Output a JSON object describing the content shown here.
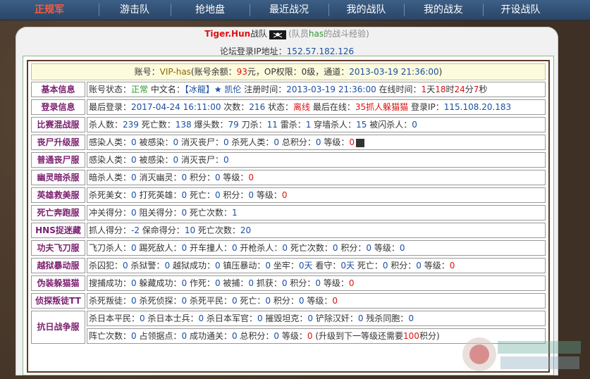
{
  "nav": {
    "items": [
      {
        "label": "正规军",
        "active": true
      },
      {
        "label": "游击队",
        "active": false
      },
      {
        "label": "抢地盘",
        "active": false
      },
      {
        "label": "最近战况",
        "active": false
      },
      {
        "label": "我的战队",
        "active": false
      },
      {
        "label": "我的战友",
        "active": false
      },
      {
        "label": "开设战队",
        "active": false
      }
    ]
  },
  "team": {
    "name": "Tiger.Hun",
    "suffix": "战队",
    "note_prefix": "(队员",
    "member": "has",
    "note_suffix": "的战斗经验)"
  },
  "ip": {
    "label": "论坛登录IP地址：",
    "value": "152.57.182.126"
  },
  "account": {
    "p1": "账号：",
    "id": "VIP-has",
    "p2": "(账号余额：",
    "balance": "93",
    "p3": "元，OP权限：0级，通道：",
    "date": "2013-03-19 21:36:00",
    "p4": ")"
  },
  "basic": {
    "cat": "基本信息",
    "status_label": "账号状态：",
    "status": "正常",
    "cn_label": " 中文名：",
    "cn": "【冰龍】★ 凯伦",
    "reg_label": " 注册时间：",
    "reg": "2013-03-19 21:36:00",
    "online_label": " 在线时间：",
    "d": "1",
    "d_u": "天",
    "h": "18",
    "h_u": "时",
    "m": "24",
    "m_u": "分",
    "s": "7",
    "s_u": "秒"
  },
  "login": {
    "cat": "登录信息",
    "last_label": "最后登录：",
    "last": "2017-04-24 16:11:00",
    "count_label": " 次数：",
    "count": "216",
    "state_label": " 状态：",
    "state": "离线",
    "server_label": " 最后在线：",
    "server": "35抓人躲猫猫",
    "ip_label": " 登录IP：",
    "ip": "115.108.20.183"
  },
  "rows": [
    {
      "cat": "比赛混战服",
      "parts": [
        [
          "t",
          "杀人数："
        ],
        [
          "n",
          "239"
        ],
        [
          "t",
          " 死亡数："
        ],
        [
          "n",
          "138"
        ],
        [
          "t",
          " 爆头数："
        ],
        [
          "n",
          "79"
        ],
        [
          "t",
          " 刀杀："
        ],
        [
          "n",
          "11"
        ],
        [
          "t",
          " 雷杀："
        ],
        [
          "n",
          "1"
        ],
        [
          "t",
          " 穿墙杀人："
        ],
        [
          "n",
          "15"
        ],
        [
          "t",
          " 被闪杀人："
        ],
        [
          "n",
          "0"
        ]
      ]
    },
    {
      "cat": "丧尸升级服",
      "parts": [
        [
          "t",
          "感染人类："
        ],
        [
          "n",
          "0"
        ],
        [
          "t",
          " 被感染："
        ],
        [
          "n",
          "0"
        ],
        [
          "t",
          " 消灭丧尸："
        ],
        [
          "n",
          "0"
        ],
        [
          "t",
          " 杀死人类："
        ],
        [
          "n",
          "0"
        ],
        [
          "t",
          " 总积分："
        ],
        [
          "n",
          "0"
        ],
        [
          "t",
          " 等级："
        ],
        [
          "r",
          "0"
        ]
      ],
      "icon": true
    },
    {
      "cat": "普通丧尸服",
      "parts": [
        [
          "t",
          "感染人类："
        ],
        [
          "n",
          "0"
        ],
        [
          "t",
          " 被感染："
        ],
        [
          "n",
          "0"
        ],
        [
          "t",
          " 消灭丧尸："
        ],
        [
          "n",
          "0"
        ]
      ]
    },
    {
      "cat": "幽灵暗杀服",
      "parts": [
        [
          "t",
          "暗杀人类："
        ],
        [
          "n",
          "0"
        ],
        [
          "t",
          " 消灭幽灵："
        ],
        [
          "n",
          "0"
        ],
        [
          "t",
          " 积分："
        ],
        [
          "n",
          "0"
        ],
        [
          "t",
          " 等级："
        ],
        [
          "r",
          "0"
        ]
      ]
    },
    {
      "cat": "英雄救美服",
      "parts": [
        [
          "t",
          "杀死美女："
        ],
        [
          "n",
          "0"
        ],
        [
          "t",
          " 打死英雄："
        ],
        [
          "n",
          "0"
        ],
        [
          "t",
          " 死亡："
        ],
        [
          "n",
          "0"
        ],
        [
          "t",
          " 积分："
        ],
        [
          "n",
          "0"
        ],
        [
          "t",
          " 等级："
        ],
        [
          "r",
          "0"
        ]
      ]
    },
    {
      "cat": "死亡奔跑服",
      "parts": [
        [
          "t",
          "冲关得分："
        ],
        [
          "n",
          "0"
        ],
        [
          "t",
          " 阻关得分："
        ],
        [
          "n",
          "0"
        ],
        [
          "t",
          " 死亡次数："
        ],
        [
          "n",
          "1"
        ]
      ]
    },
    {
      "cat": "HNS捉迷藏",
      "parts": [
        [
          "t",
          "抓人得分："
        ],
        [
          "n",
          "-2"
        ],
        [
          "t",
          " 保命得分："
        ],
        [
          "n",
          "10"
        ],
        [
          "t",
          " 死亡次数："
        ],
        [
          "n",
          "20"
        ]
      ]
    },
    {
      "cat": "功夫飞刀服",
      "parts": [
        [
          "t",
          "飞刀杀人："
        ],
        [
          "n",
          "0"
        ],
        [
          "t",
          " 踢死敌人："
        ],
        [
          "n",
          "0"
        ],
        [
          "t",
          " 开车撞人："
        ],
        [
          "n",
          "0"
        ],
        [
          "t",
          " 开枪杀人："
        ],
        [
          "n",
          "0"
        ],
        [
          "t",
          " 死亡次数："
        ],
        [
          "n",
          "0"
        ],
        [
          "t",
          " 积分："
        ],
        [
          "n",
          "0"
        ],
        [
          "t",
          " 等级："
        ],
        [
          "n",
          "0"
        ]
      ]
    },
    {
      "cat": "越狱暴动服",
      "parts": [
        [
          "t",
          "杀囚犯："
        ],
        [
          "n",
          "0"
        ],
        [
          "t",
          " 杀狱警："
        ],
        [
          "n",
          "0"
        ],
        [
          "t",
          " 越狱成功："
        ],
        [
          "n",
          "0"
        ],
        [
          "t",
          " 镇压暴动："
        ],
        [
          "n",
          "0"
        ],
        [
          "t",
          " 坐牢："
        ],
        [
          "n",
          "0天"
        ],
        [
          "t",
          " 看守："
        ],
        [
          "n",
          "0天"
        ],
        [
          "t",
          " 死亡："
        ],
        [
          "n",
          "0"
        ],
        [
          "t",
          " 积分："
        ],
        [
          "n",
          "0"
        ],
        [
          "t",
          " 等级："
        ],
        [
          "r",
          "0"
        ]
      ]
    },
    {
      "cat": "伪装躲猫猫",
      "parts": [
        [
          "t",
          "搜捕成功："
        ],
        [
          "n",
          "0"
        ],
        [
          "t",
          " 躲藏成功："
        ],
        [
          "n",
          "0"
        ],
        [
          "t",
          " 作死："
        ],
        [
          "n",
          "0"
        ],
        [
          "t",
          " 被捕："
        ],
        [
          "n",
          "0"
        ],
        [
          "t",
          " 抓获："
        ],
        [
          "n",
          "0"
        ],
        [
          "t",
          " 积分："
        ],
        [
          "n",
          "0"
        ],
        [
          "t",
          " 等级："
        ],
        [
          "r",
          "0"
        ]
      ]
    },
    {
      "cat": "侦探叛徒TT",
      "parts": [
        [
          "t",
          "杀死叛徒："
        ],
        [
          "n",
          "0"
        ],
        [
          "t",
          " 杀死侦探："
        ],
        [
          "n",
          "0"
        ],
        [
          "t",
          " 杀死平民："
        ],
        [
          "n",
          "0"
        ],
        [
          "t",
          " 死亡："
        ],
        [
          "n",
          "0"
        ],
        [
          "t",
          " 积分："
        ],
        [
          "n",
          "0"
        ],
        [
          "t",
          " 等级："
        ],
        [
          "r",
          "0"
        ]
      ]
    }
  ],
  "war": {
    "cat": "抗日战争服",
    "line1": [
      [
        "t",
        "杀日本平民："
      ],
      [
        "n",
        "0"
      ],
      [
        "t",
        " 杀日本士兵："
      ],
      [
        "n",
        "0"
      ],
      [
        "t",
        " 杀日本军官："
      ],
      [
        "n",
        "0"
      ],
      [
        "t",
        " 摧毁坦克："
      ],
      [
        "n",
        "0"
      ],
      [
        "t",
        " 铲除汉奸："
      ],
      [
        "n",
        "0"
      ],
      [
        "t",
        " 残杀同胞："
      ],
      [
        "n",
        "0"
      ]
    ],
    "line2": [
      [
        "t",
        "阵亡次数："
      ],
      [
        "n",
        "0"
      ],
      [
        "t",
        " 占领据点："
      ],
      [
        "n",
        "0"
      ],
      [
        "t",
        " 成功通关："
      ],
      [
        "n",
        "0"
      ],
      [
        "t",
        " 总积分："
      ],
      [
        "n",
        "0"
      ],
      [
        "t",
        " 等级："
      ],
      [
        "r",
        "0"
      ],
      [
        "t",
        " (升级到下一等级还需要"
      ],
      [
        "r",
        "100"
      ],
      [
        "t",
        "积分)"
      ]
    ]
  },
  "colors": {
    "number": "#1a4fa3",
    "red": "#d11111",
    "category": "#7a1e6e",
    "nav": "#2a4566"
  }
}
